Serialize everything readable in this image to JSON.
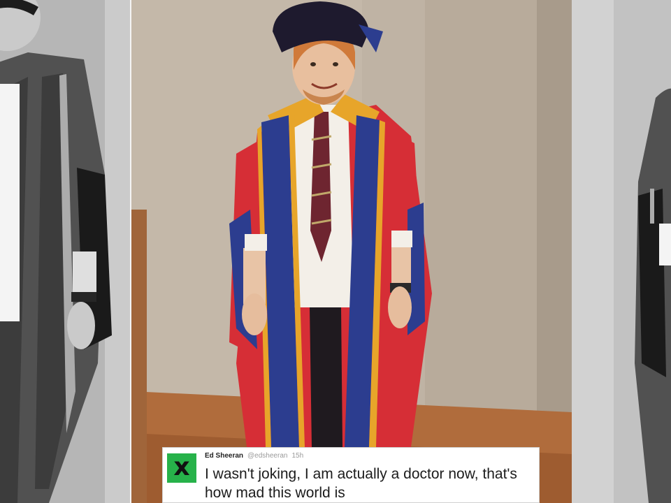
{
  "tweet": {
    "name": "Ed Sheeran",
    "handle": "@edsheeran",
    "time": "15h",
    "text": "I wasn't joking, I am actually a doctor now, that's how mad this world is",
    "avatar_glyph": "x",
    "avatar_color": "#27b24a"
  },
  "colors": {
    "gown_red": "#d62e36",
    "gown_blue": "#2c3d8f",
    "gown_gold": "#e7a52a",
    "hat": "#1e1a2e",
    "wall": "#bfb3a4"
  }
}
